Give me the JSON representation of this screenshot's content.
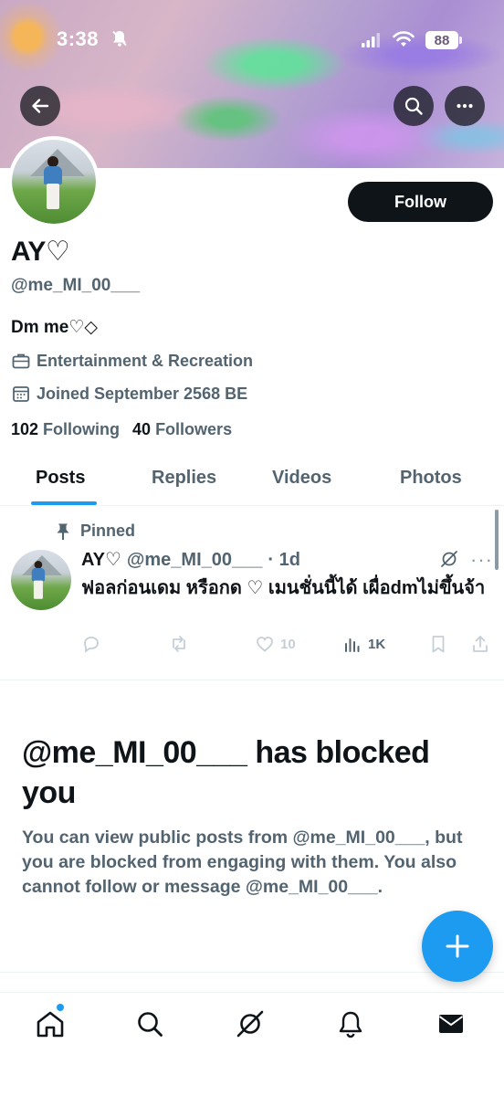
{
  "status_bar": {
    "time": "3:38",
    "battery": "88"
  },
  "profile": {
    "display_name": "AY♡",
    "handle": "@me_MI_00___",
    "bio": "Dm me♡◇",
    "category": "Entertainment & Recreation",
    "joined": "Joined September 2568 BE",
    "following_count": "102",
    "following_label": "Following",
    "followers_count": "40",
    "followers_label": "Followers",
    "follow_button": "Follow"
  },
  "tabs": [
    {
      "label": "Posts",
      "active": true
    },
    {
      "label": "Replies",
      "active": false
    },
    {
      "label": "Videos",
      "active": false
    },
    {
      "label": "Photos",
      "active": false
    }
  ],
  "pinned_post": {
    "pinned_label": "Pinned",
    "name": "AY♡",
    "handle": "@me_MI_00___",
    "time": "· 1d",
    "text": "ฟอลก่อนเดม หรือกด ♡ เมนชั่นนี้ได้ เผื่อdmไม่ขึ้นจ้า",
    "likes": "10",
    "views": "1K"
  },
  "blocked": {
    "title": "@me_MI_00___ has blocked you",
    "body": "You can view public posts from @me_MI_00___, but you are blocked from engaging with them. You also cannot follow or message @me_MI_00___."
  },
  "colors": {
    "accent": "#1d9bf0",
    "text": "#0f1419",
    "secondary": "#536471"
  },
  "icons": [
    "back-arrow-icon",
    "search-icon",
    "more-icon",
    "briefcase-icon",
    "calendar-icon",
    "pin-icon",
    "grok-icon",
    "reply-icon",
    "repost-icon",
    "like-icon",
    "views-icon",
    "bookmark-icon",
    "share-icon",
    "plus-icon",
    "home-icon",
    "explore-icon",
    "grok-nav-icon",
    "notifications-icon",
    "messages-icon"
  ]
}
